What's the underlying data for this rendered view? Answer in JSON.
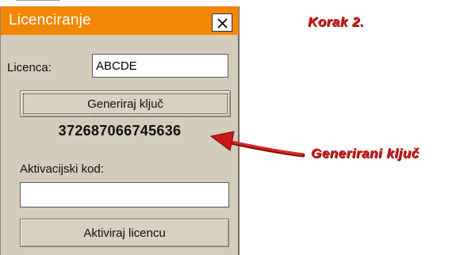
{
  "window": {
    "title": "Licenciranje",
    "close_symbol": "×"
  },
  "form": {
    "license_label": "Licenca:",
    "license_value": "ABCDE",
    "generate_button": "Generiraj ključ",
    "generated_key": "372687066745636",
    "activation_label": "Aktivacijski kod:",
    "activation_value": "",
    "activate_button": "Aktiviraj licencu"
  },
  "annotations": {
    "step": "Korak 2.",
    "arrow_label": "Generirani ključ"
  },
  "colors": {
    "titlebar": "#f28705",
    "dialog_bg": "#d4ccba",
    "annotation": "#d31b1b"
  }
}
